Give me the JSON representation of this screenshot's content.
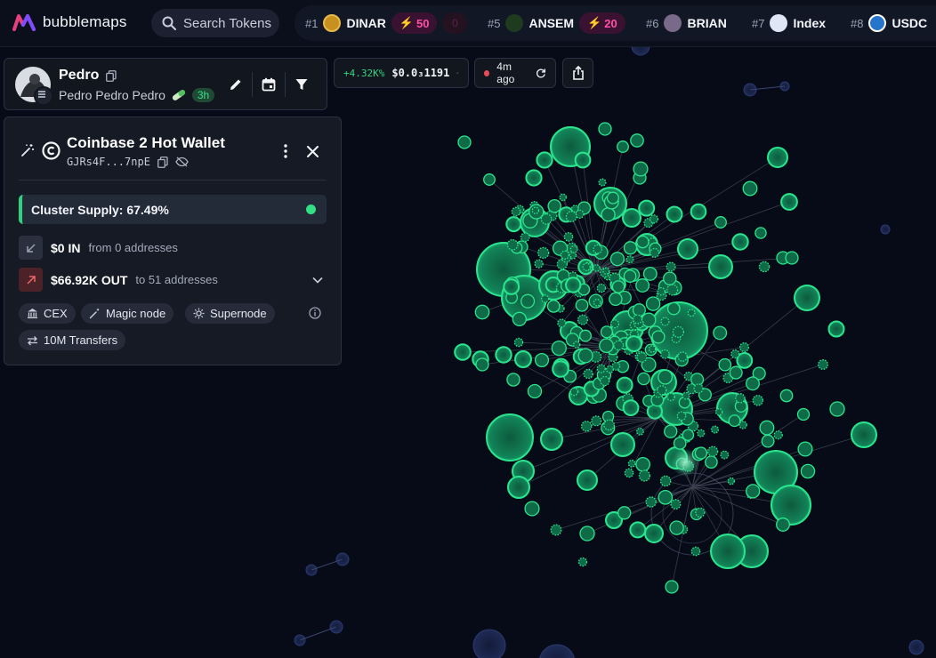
{
  "topbar": {
    "logo_text": "bubblemaps",
    "search_placeholder": "Search Tokens",
    "tokens": [
      {
        "rank": "#1",
        "name": "DINAR",
        "boost": "50",
        "coin_color": "#c8901f"
      },
      {
        "rank": "#5",
        "name": "ANSEM",
        "boost": "20",
        "coin_color": "#2a5a2a"
      },
      {
        "rank": "#6",
        "name": "BRIAN",
        "coin_color": "#7a6a8a"
      },
      {
        "rank": "#7",
        "name": "Index",
        "coin_color": "#dfe6f5"
      },
      {
        "rank": "#8",
        "name": "USDC",
        "coin_color": "#2775ca"
      }
    ],
    "ghost_boost": "0"
  },
  "user": {
    "name": "Pedro",
    "subtitle": "Pedro Pedro Pedro",
    "age": "3h"
  },
  "metrics": {
    "change": "+4.32K%",
    "price": "$0.0₃1191",
    "updated": "4m ago"
  },
  "wallet": {
    "title": "Coinbase 2 Hot Wallet",
    "address": "GJRs4F...7npE",
    "cluster_supply": "Cluster Supply: 67.49%",
    "in_amount": "$0 IN",
    "in_desc": "from 0 addresses",
    "out_amount": "$66.92K OUT",
    "out_desc": "to 51 addresses",
    "tags": [
      "CEX",
      "Magic node",
      "Supernode",
      "10M Transfers"
    ]
  },
  "colors": {
    "accent_green": "#2fd07f",
    "boost_pink": "#ff4fa6",
    "background": "#070b17"
  }
}
